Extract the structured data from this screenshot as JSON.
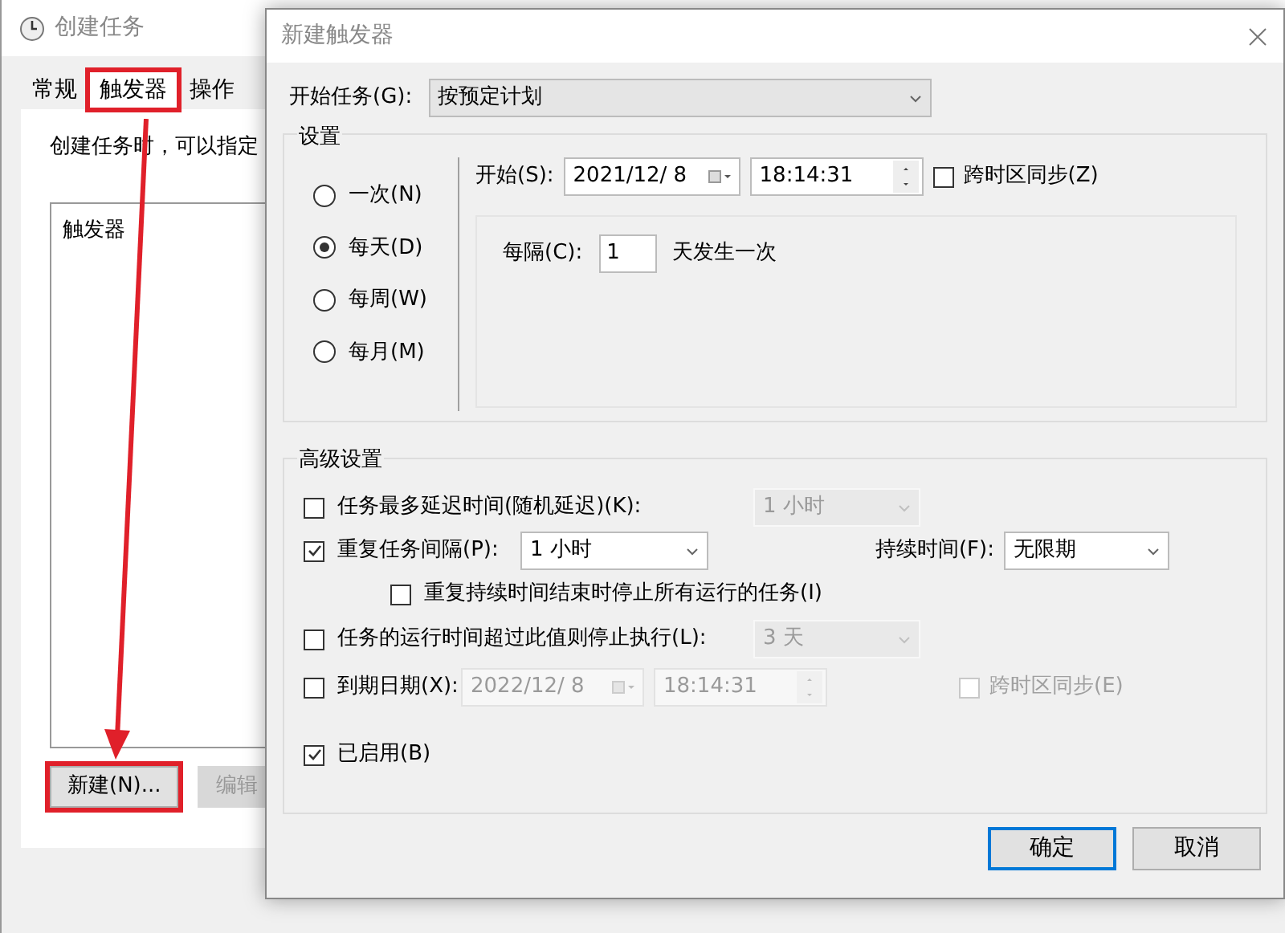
{
  "back_window": {
    "title": "创建任务",
    "tabs": [
      {
        "label": "常规",
        "selected": false,
        "highlighted": false
      },
      {
        "label": "触发器",
        "selected": true,
        "highlighted": true
      },
      {
        "label": "操作",
        "selected": false,
        "highlighted": false
      }
    ],
    "description": "创建任务时，可以指定",
    "list": {
      "column": "触发器"
    },
    "buttons": [
      {
        "label": "新建(N)...",
        "disabled": false,
        "highlighted": true
      },
      {
        "label": "编辑",
        "disabled": true,
        "highlighted": false
      }
    ]
  },
  "dialog": {
    "title": "新建触发器",
    "begin": {
      "label": "开始任务(G):",
      "value": "按预定计划"
    },
    "settings": {
      "title": "设置",
      "schedules": [
        {
          "label": "一次(N)",
          "selected": false
        },
        {
          "label": "每天(D)",
          "selected": true
        },
        {
          "label": "每周(W)",
          "selected": false
        },
        {
          "label": "每月(M)",
          "selected": false
        }
      ],
      "start": {
        "label": "开始(S):",
        "date": "2021/12/ 8",
        "time": "18:14:31"
      },
      "sync": {
        "label": "跨时区同步(Z)",
        "checked": false
      },
      "recur": {
        "label": "每隔(C):",
        "value": "1",
        "suffix": "天发生一次"
      }
    },
    "advanced": {
      "title": "高级设置",
      "delay": {
        "label": "任务最多延迟时间(随机延迟)(K):",
        "checked": false,
        "value": "1 小时"
      },
      "repeat": {
        "label": "重复任务间隔(P):",
        "checked": true,
        "value": "1 小时",
        "duration_label": "持续时间(F):",
        "duration": "无限期"
      },
      "stop_at_end": {
        "label": "重复持续时间结束时停止所有运行的任务(I)",
        "checked": false
      },
      "stop_after": {
        "label": "任务的运行时间超过此值则停止执行(L):",
        "checked": false,
        "value": "3 天"
      },
      "expire": {
        "label": "到期日期(X):",
        "checked": false,
        "date": "2022/12/ 8",
        "time": "18:14:31",
        "sync_label": "跨时区同步(E)",
        "sync_checked": false
      },
      "enabled": {
        "label": "已启用(B)",
        "checked": true
      }
    },
    "buttons": [
      {
        "label": "确定",
        "default": true
      },
      {
        "label": "取消",
        "default": false
      }
    ]
  }
}
